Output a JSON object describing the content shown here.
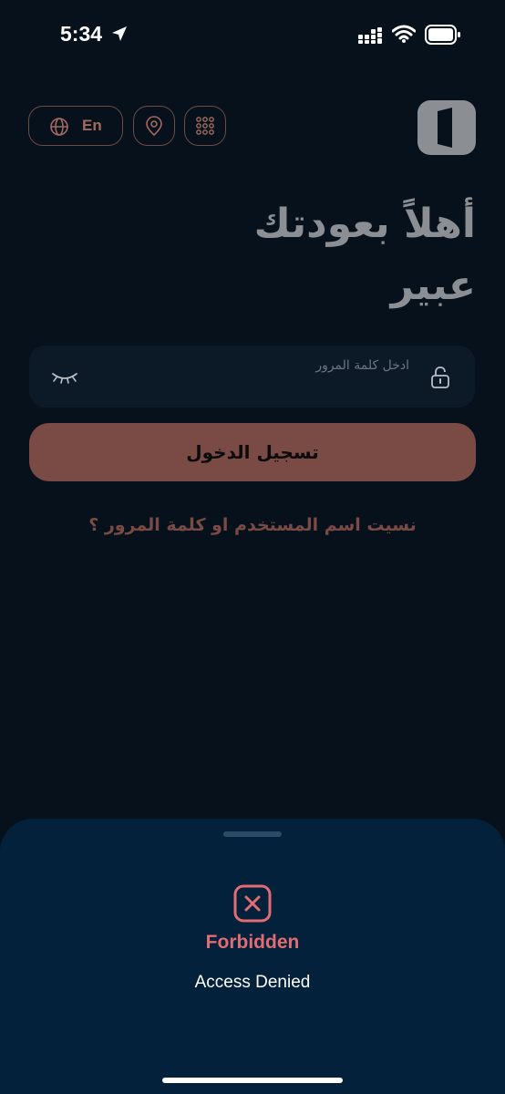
{
  "status_bar": {
    "time": "5:34"
  },
  "header": {
    "language_label": "En"
  },
  "welcome": {
    "line1": "أهلاً بعودتك",
    "line2": "عبير"
  },
  "password": {
    "placeholder": "ادخل كلمة المرور"
  },
  "login_button": {
    "label": "تسجيل الدخول"
  },
  "forgot_link": {
    "label": "نسيت اسم المستخدم او كلمة المرور ؟"
  },
  "error_sheet": {
    "title": "Forbidden",
    "message": "Access Denied"
  },
  "colors": {
    "background": "#06111c",
    "accent": "#7a4a44",
    "sheet": "#03213a",
    "error": "#e26c73"
  },
  "icons": [
    "location-arrow-icon",
    "signal-icon",
    "wifi-icon",
    "battery-icon",
    "globe-icon",
    "location-pin-icon",
    "grid-icon",
    "logo-icon",
    "lock-icon",
    "eye-closed-icon",
    "close-x-icon"
  ]
}
